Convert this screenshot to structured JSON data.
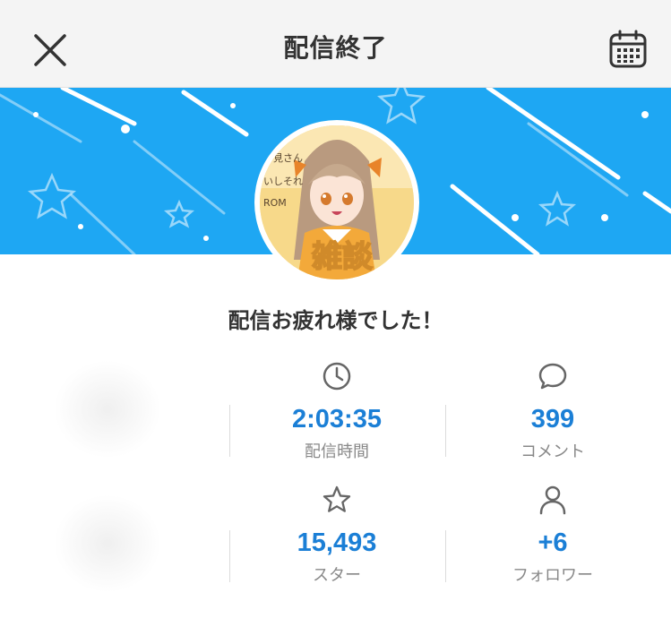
{
  "header": {
    "title": "配信終了",
    "close_icon": "close-icon",
    "calendar_icon": "calendar-icon"
  },
  "banner": {
    "color": "#1ea7f3",
    "avatar_caption": "雑談",
    "avatar_side_text": [
      "お見さん",
      "いしそれ",
      "ROM"
    ]
  },
  "message": "配信お疲れ様でした！",
  "stats": {
    "duration": {
      "icon": "clock-icon",
      "value": "2:03:35",
      "label": "配信時間"
    },
    "comments": {
      "icon": "comment-icon",
      "value": "399",
      "label": "コメント"
    },
    "stars": {
      "icon": "star-icon",
      "value": "15,493",
      "label": "スター"
    },
    "followers": {
      "icon": "person-icon",
      "value": "+6",
      "label": "フォロワー"
    }
  },
  "colors": {
    "accent": "#1b7fd6",
    "label": "#888888"
  }
}
